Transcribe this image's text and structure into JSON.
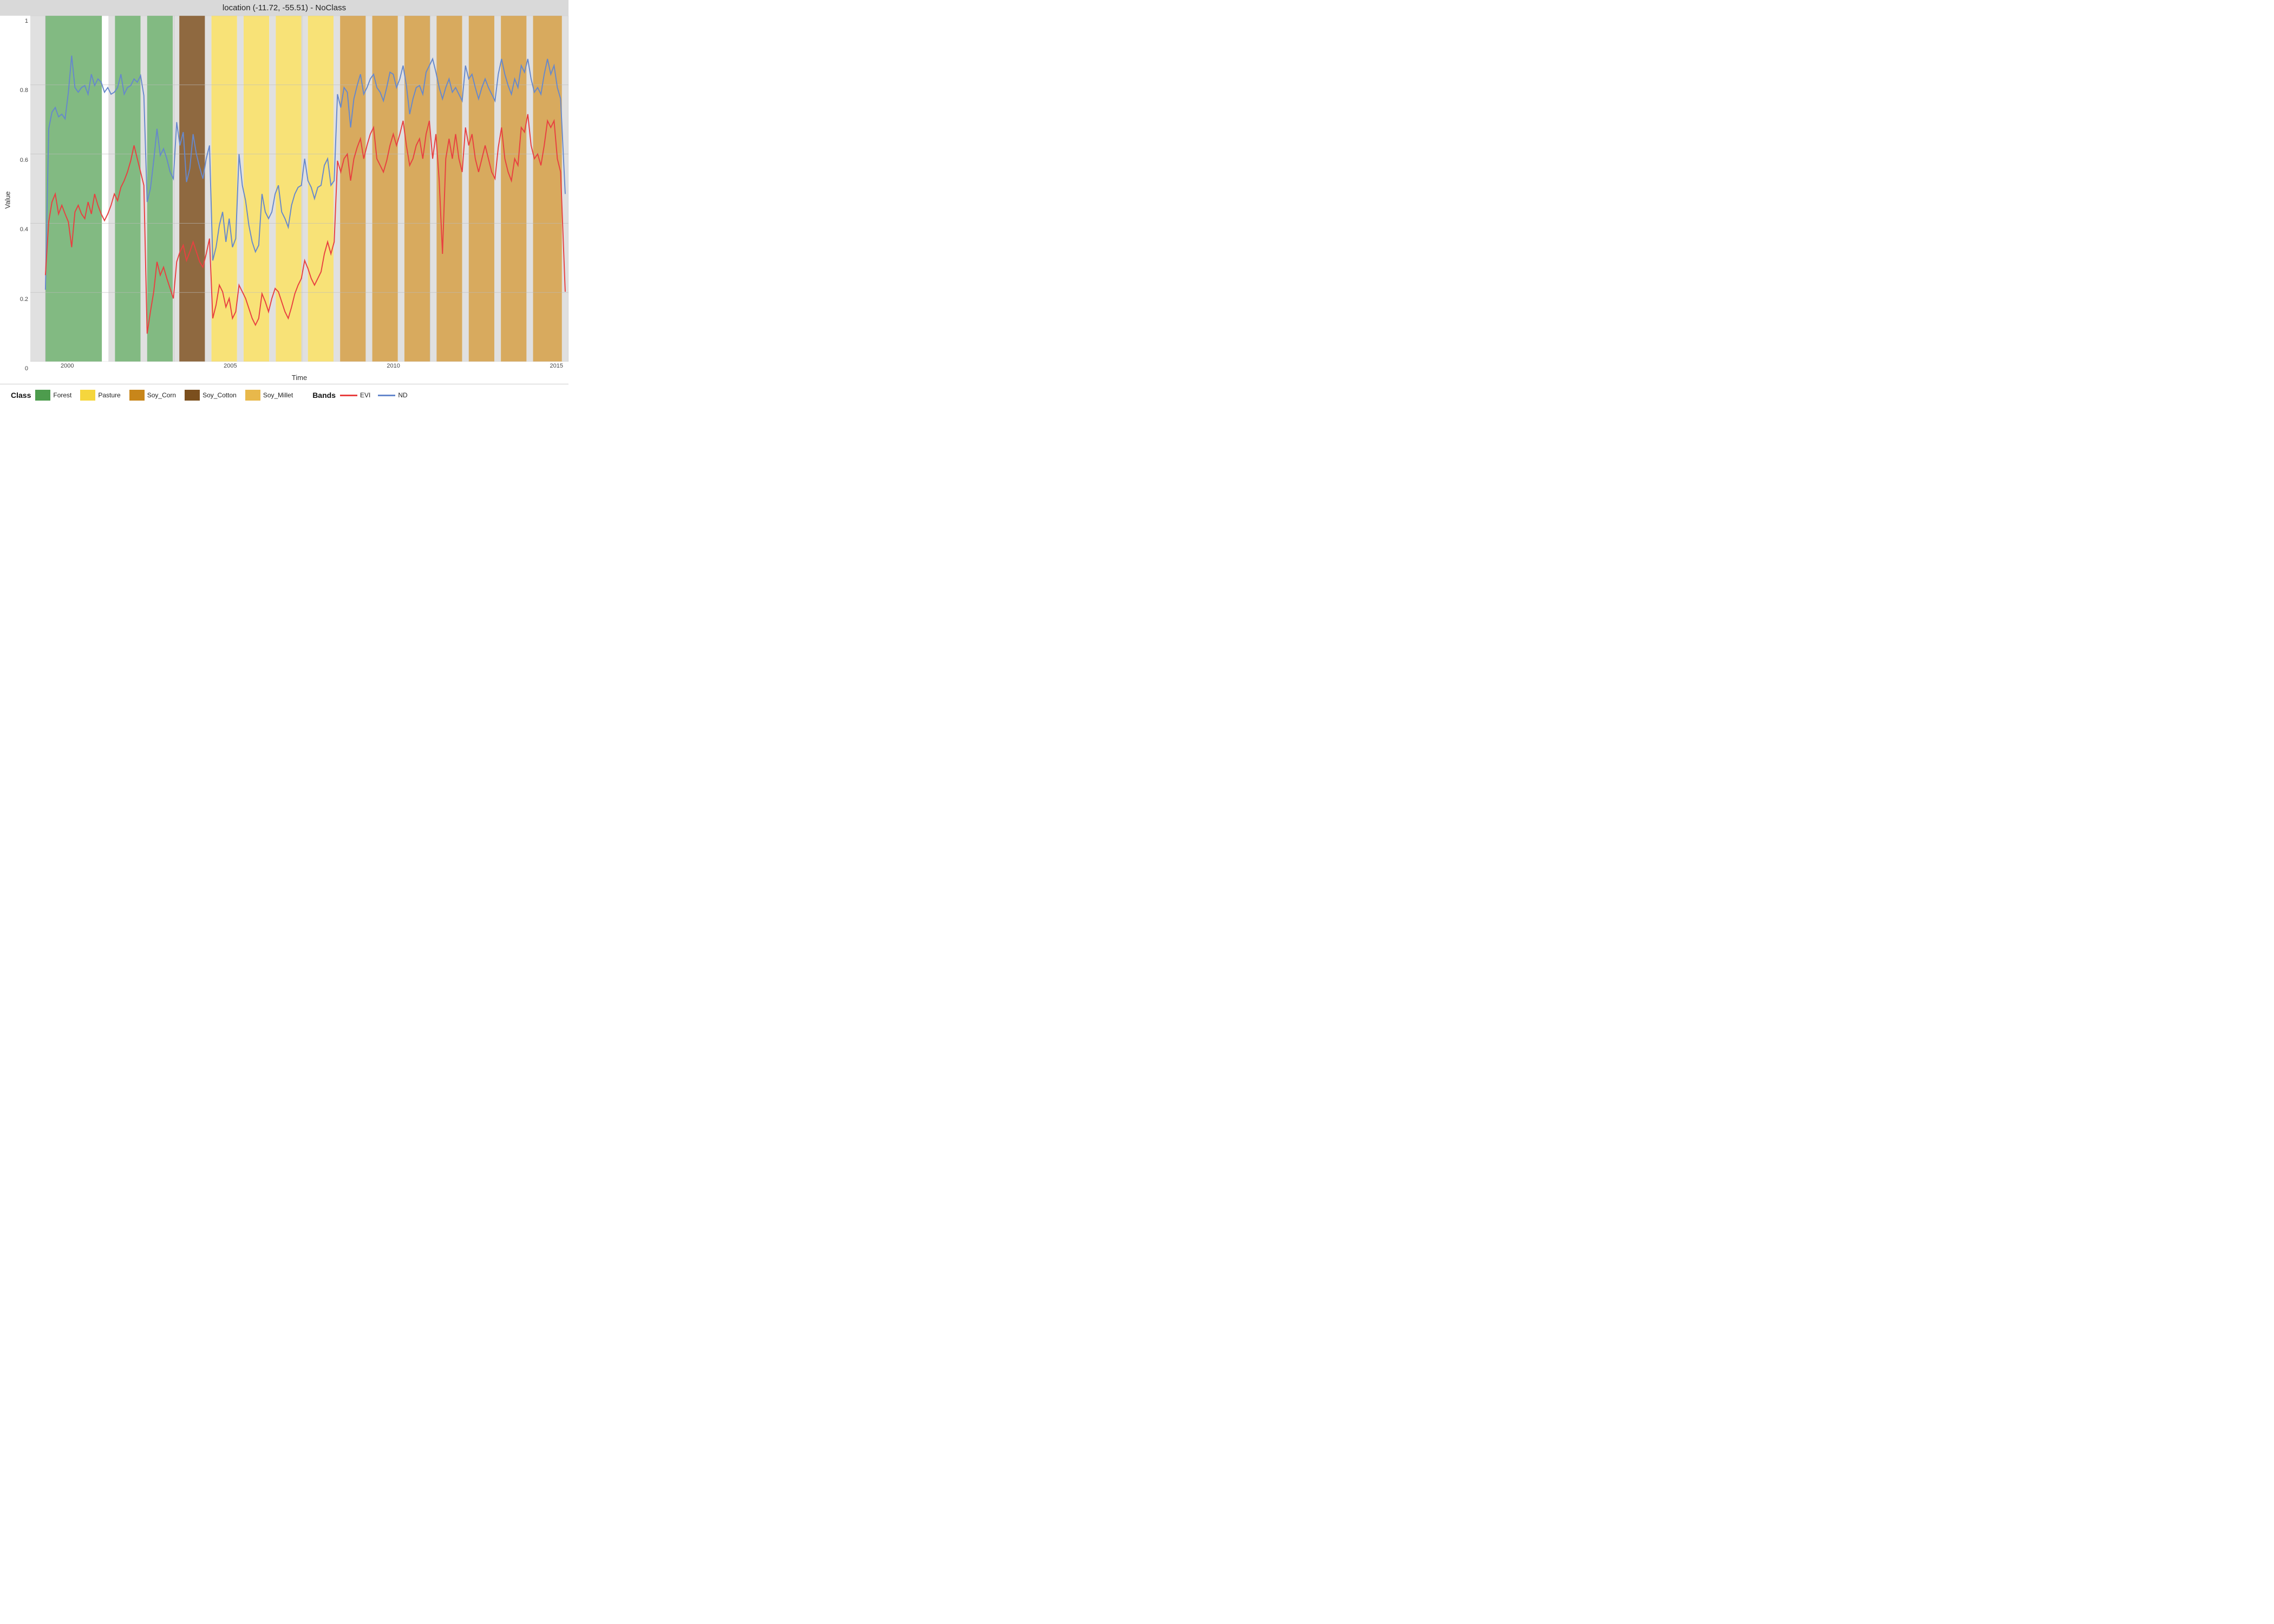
{
  "title": "location (-11.72, -55.51) - NoClass",
  "yAxis": {
    "label": "Value",
    "ticks": [
      "1",
      "0.8",
      "0.6",
      "0.4",
      "0.2",
      "0"
    ]
  },
  "xAxis": {
    "label": "Time",
    "ticks": [
      "2000",
      "2005",
      "2010",
      "2015"
    ]
  },
  "legend": {
    "classLabel": "Class",
    "bandsLabel": "Bands",
    "classes": [
      {
        "name": "Forest",
        "color": "#4d9c4d"
      },
      {
        "name": "Pasture",
        "color": "#f5d63d"
      },
      {
        "name": "Soy_Corn",
        "color": "#c8861a"
      },
      {
        "name": "Soy_Cotton",
        "color": "#7b4f1e"
      },
      {
        "name": "Soy_Millet",
        "color": "#e8b84b"
      }
    ],
    "bands": [
      {
        "name": "EVI",
        "color": "#e84040"
      },
      {
        "name": "ND",
        "color": "#6688cc"
      }
    ]
  },
  "background_regions": [
    {
      "label": "gray-start",
      "x": 0,
      "width": 0.028,
      "color": "#e0e0e0"
    },
    {
      "label": "forest1",
      "x": 0.028,
      "width": 0.105,
      "color": "#4d9c4d"
    },
    {
      "label": "gray1",
      "x": 0.133,
      "width": 0.012,
      "color": "#e0e0e0"
    },
    {
      "label": "forest2",
      "x": 0.145,
      "width": 0.048,
      "color": "#4d9c4d"
    },
    {
      "label": "gray2",
      "x": 0.193,
      "width": 0.012,
      "color": "#e0e0e0"
    },
    {
      "label": "forest3",
      "x": 0.205,
      "width": 0.048,
      "color": "#4d9c4d"
    },
    {
      "label": "gray3",
      "x": 0.253,
      "width": 0.012,
      "color": "#e0e0e0"
    },
    {
      "label": "soy_cotton1",
      "x": 0.265,
      "width": 0.048,
      "color": "#7b4f1e"
    },
    {
      "label": "gray4",
      "x": 0.313,
      "width": 0.012,
      "color": "#e0e0e0"
    },
    {
      "label": "pasture1",
      "x": 0.325,
      "width": 0.048,
      "color": "#f5d63d"
    },
    {
      "label": "gray5",
      "x": 0.373,
      "width": 0.012,
      "color": "#e0e0e0"
    },
    {
      "label": "pasture2",
      "x": 0.385,
      "width": 0.048,
      "color": "#f5d63d"
    },
    {
      "label": "gray6",
      "x": 0.433,
      "width": 0.012,
      "color": "#e0e0e0"
    },
    {
      "label": "pasture3",
      "x": 0.445,
      "width": 0.048,
      "color": "#f5d63d"
    },
    {
      "label": "gray7",
      "x": 0.493,
      "width": 0.012,
      "color": "#e0e0e0"
    },
    {
      "label": "pasture4",
      "x": 0.505,
      "width": 0.048,
      "color": "#f5d63d"
    },
    {
      "label": "gray8",
      "x": 0.553,
      "width": 0.012,
      "color": "#e0e0e0"
    },
    {
      "label": "soy_corn1",
      "x": 0.565,
      "width": 0.048,
      "color": "#c8861a"
    },
    {
      "label": "gray9",
      "x": 0.613,
      "width": 0.012,
      "color": "#e0e0e0"
    },
    {
      "label": "soy_corn2",
      "x": 0.625,
      "width": 0.048,
      "color": "#c8861a"
    },
    {
      "label": "gray10",
      "x": 0.673,
      "width": 0.012,
      "color": "#e0e0e0"
    },
    {
      "label": "soy_corn3",
      "x": 0.685,
      "width": 0.048,
      "color": "#c8861a"
    },
    {
      "label": "gray11",
      "x": 0.733,
      "width": 0.012,
      "color": "#e0e0e0"
    },
    {
      "label": "soy_corn4",
      "x": 0.745,
      "width": 0.048,
      "color": "#c8861a"
    },
    {
      "label": "gray12",
      "x": 0.793,
      "width": 0.012,
      "color": "#e0e0e0"
    },
    {
      "label": "soy_corn5",
      "x": 0.805,
      "width": 0.048,
      "color": "#c8861a"
    },
    {
      "label": "gray13",
      "x": 0.853,
      "width": 0.012,
      "color": "#e0e0e0"
    },
    {
      "label": "soy_corn6",
      "x": 0.865,
      "width": 0.048,
      "color": "#c8861a"
    },
    {
      "label": "gray14",
      "x": 0.913,
      "width": 0.012,
      "color": "#e0e0e0"
    },
    {
      "label": "soy_corn7",
      "x": 0.925,
      "width": 0.06,
      "color": "#c8861a"
    },
    {
      "label": "gray-end",
      "x": 0.985,
      "width": 0.015,
      "color": "#e0e0e0"
    }
  ]
}
